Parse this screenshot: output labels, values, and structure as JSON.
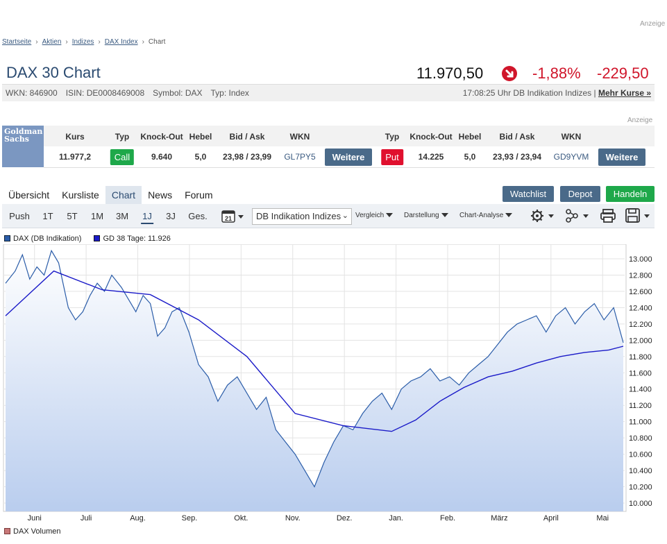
{
  "ads": {
    "top_label": "Anzeige",
    "mid_label": "Anzeige"
  },
  "breadcrumb": {
    "items": [
      "Startseite",
      "Aktien",
      "Indizes",
      "DAX Index"
    ],
    "current": "Chart"
  },
  "header": {
    "title": "DAX 30 Chart",
    "price": "11.970,50",
    "change_pct": "-1,88%",
    "change_abs": "-229,50",
    "status_color": "#d0152a",
    "wkn": "WKN: 846900",
    "isin": "ISIN: DE0008469008",
    "symbol": "Symbol: DAX",
    "typ": "Typ: Index",
    "time_info": "17:08:25 Uhr DB Indikation Indizes |",
    "more_link": "Mehr Kurse »"
  },
  "derivatives": {
    "logo_text": "Goldman Sachs",
    "headers_left": [
      "Kurs",
      "Typ",
      "Knock-Out",
      "Hebel",
      "Bid / Ask",
      "WKN"
    ],
    "headers_right": [
      "Typ",
      "Knock-Out",
      "Hebel",
      "Bid / Ask",
      "WKN"
    ],
    "kurs": "11.977,2",
    "call": {
      "type": "Call",
      "knockout": "9.640",
      "hebel": "5,0",
      "bid_ask": "23,98 / 23,99",
      "wkn": "GL7PY5",
      "button": "Weitere",
      "color": "#1ea84a"
    },
    "put": {
      "type": "Put",
      "knockout": "14.225",
      "hebel": "5,0",
      "bid_ask": "23,93 / 23,94",
      "wkn": "GD9YVM",
      "button": "Weitere",
      "color": "#e0102e"
    }
  },
  "tabs": [
    {
      "label": "Übersicht",
      "active": false
    },
    {
      "label": "Kursliste",
      "active": false
    },
    {
      "label": "Chart",
      "active": true
    },
    {
      "label": "News",
      "active": false
    },
    {
      "label": "Forum",
      "active": false
    }
  ],
  "actions": {
    "watchlist": "Watchlist",
    "depot": "Depot",
    "handeln": "Handeln",
    "watchlist_color": "#4a6a89",
    "handeln_color": "#1ea84a"
  },
  "toolbar": {
    "ranges": [
      "Push",
      "1T",
      "5T",
      "1M",
      "3M",
      "1J",
      "3J",
      "Ges."
    ],
    "active_range": "1J",
    "calendar_icon": "calendar-icon",
    "calendar_label": "21",
    "source_select": "DB Indikation Indizes",
    "vergleich": "Vergleich",
    "darstellung": "Darstellung",
    "analyse": "Chart-Analyse",
    "icons": [
      "gear-icon",
      "share-icon",
      "print-icon",
      "save-icon"
    ]
  },
  "chart_data": {
    "type": "area",
    "series": [
      {
        "name": "DAX (DB Indikation)",
        "color": "#2a5ca8",
        "x_index": [
          0,
          4,
          7,
          10,
          13,
          16,
          19,
          22,
          26,
          29,
          32,
          35,
          38,
          41,
          44,
          48,
          51,
          54,
          57,
          60,
          63,
          66,
          69,
          72,
          76,
          80,
          84,
          88,
          92,
          96,
          100,
          104,
          108,
          112,
          116,
          120,
          124,
          128,
          132,
          136,
          140,
          144,
          148,
          152,
          156,
          160,
          164,
          168,
          172,
          176,
          180,
          184,
          188,
          192,
          196,
          200,
          204,
          208,
          212,
          216,
          220,
          224,
          228,
          232,
          236,
          240,
          244,
          248,
          252,
          256
        ],
        "values": [
          12700,
          12850,
          13050,
          12750,
          12900,
          12800,
          13100,
          12950,
          12400,
          12250,
          12350,
          12550,
          12700,
          12600,
          12800,
          12650,
          12500,
          12350,
          12550,
          12450,
          12050,
          12150,
          12350,
          12400,
          12100,
          11700,
          11550,
          11250,
          11450,
          11550,
          11350,
          11150,
          11300,
          10900,
          10750,
          10600,
          10400,
          10200,
          10500,
          10750,
          10950,
          10900,
          11100,
          11250,
          11350,
          11150,
          11400,
          11500,
          11550,
          11650,
          11500,
          11550,
          11450,
          11600,
          11700,
          11800,
          11950,
          12100,
          12200,
          12250,
          12300,
          12100,
          12300,
          12400,
          12200,
          12350,
          12450,
          12250,
          12400,
          11970
        ]
      },
      {
        "name": "GD 38 Tage: 11.926",
        "color": "#1a1ac8",
        "x_index": [
          0,
          20,
          40,
          60,
          80,
          100,
          120,
          140,
          160,
          170,
          180,
          190,
          200,
          210,
          220,
          230,
          240,
          250,
          256
        ],
        "values": [
          12300,
          12850,
          12620,
          12560,
          12250,
          11800,
          11100,
          10950,
          10880,
          11020,
          11250,
          11420,
          11550,
          11620,
          11720,
          11800,
          11850,
          11880,
          11926
        ]
      }
    ],
    "x_labels": [
      "Juni",
      "Juli",
      "Aug.",
      "Sep.",
      "Okt.",
      "Nov.",
      "Dez.",
      "Jan.",
      "Feb.",
      "März",
      "April",
      "Mai"
    ],
    "y_ticks": [
      "13.000",
      "12.800",
      "12.600",
      "12.400",
      "12.200",
      "12.000",
      "11.800",
      "11.600",
      "11.400",
      "11.200",
      "11.000",
      "10.800",
      "10.600",
      "10.400",
      "10.200",
      "10.000"
    ],
    "ylim": [
      10000,
      13000
    ],
    "grid": true,
    "legend_position": "top-left",
    "volume_label": "DAX Volumen"
  }
}
